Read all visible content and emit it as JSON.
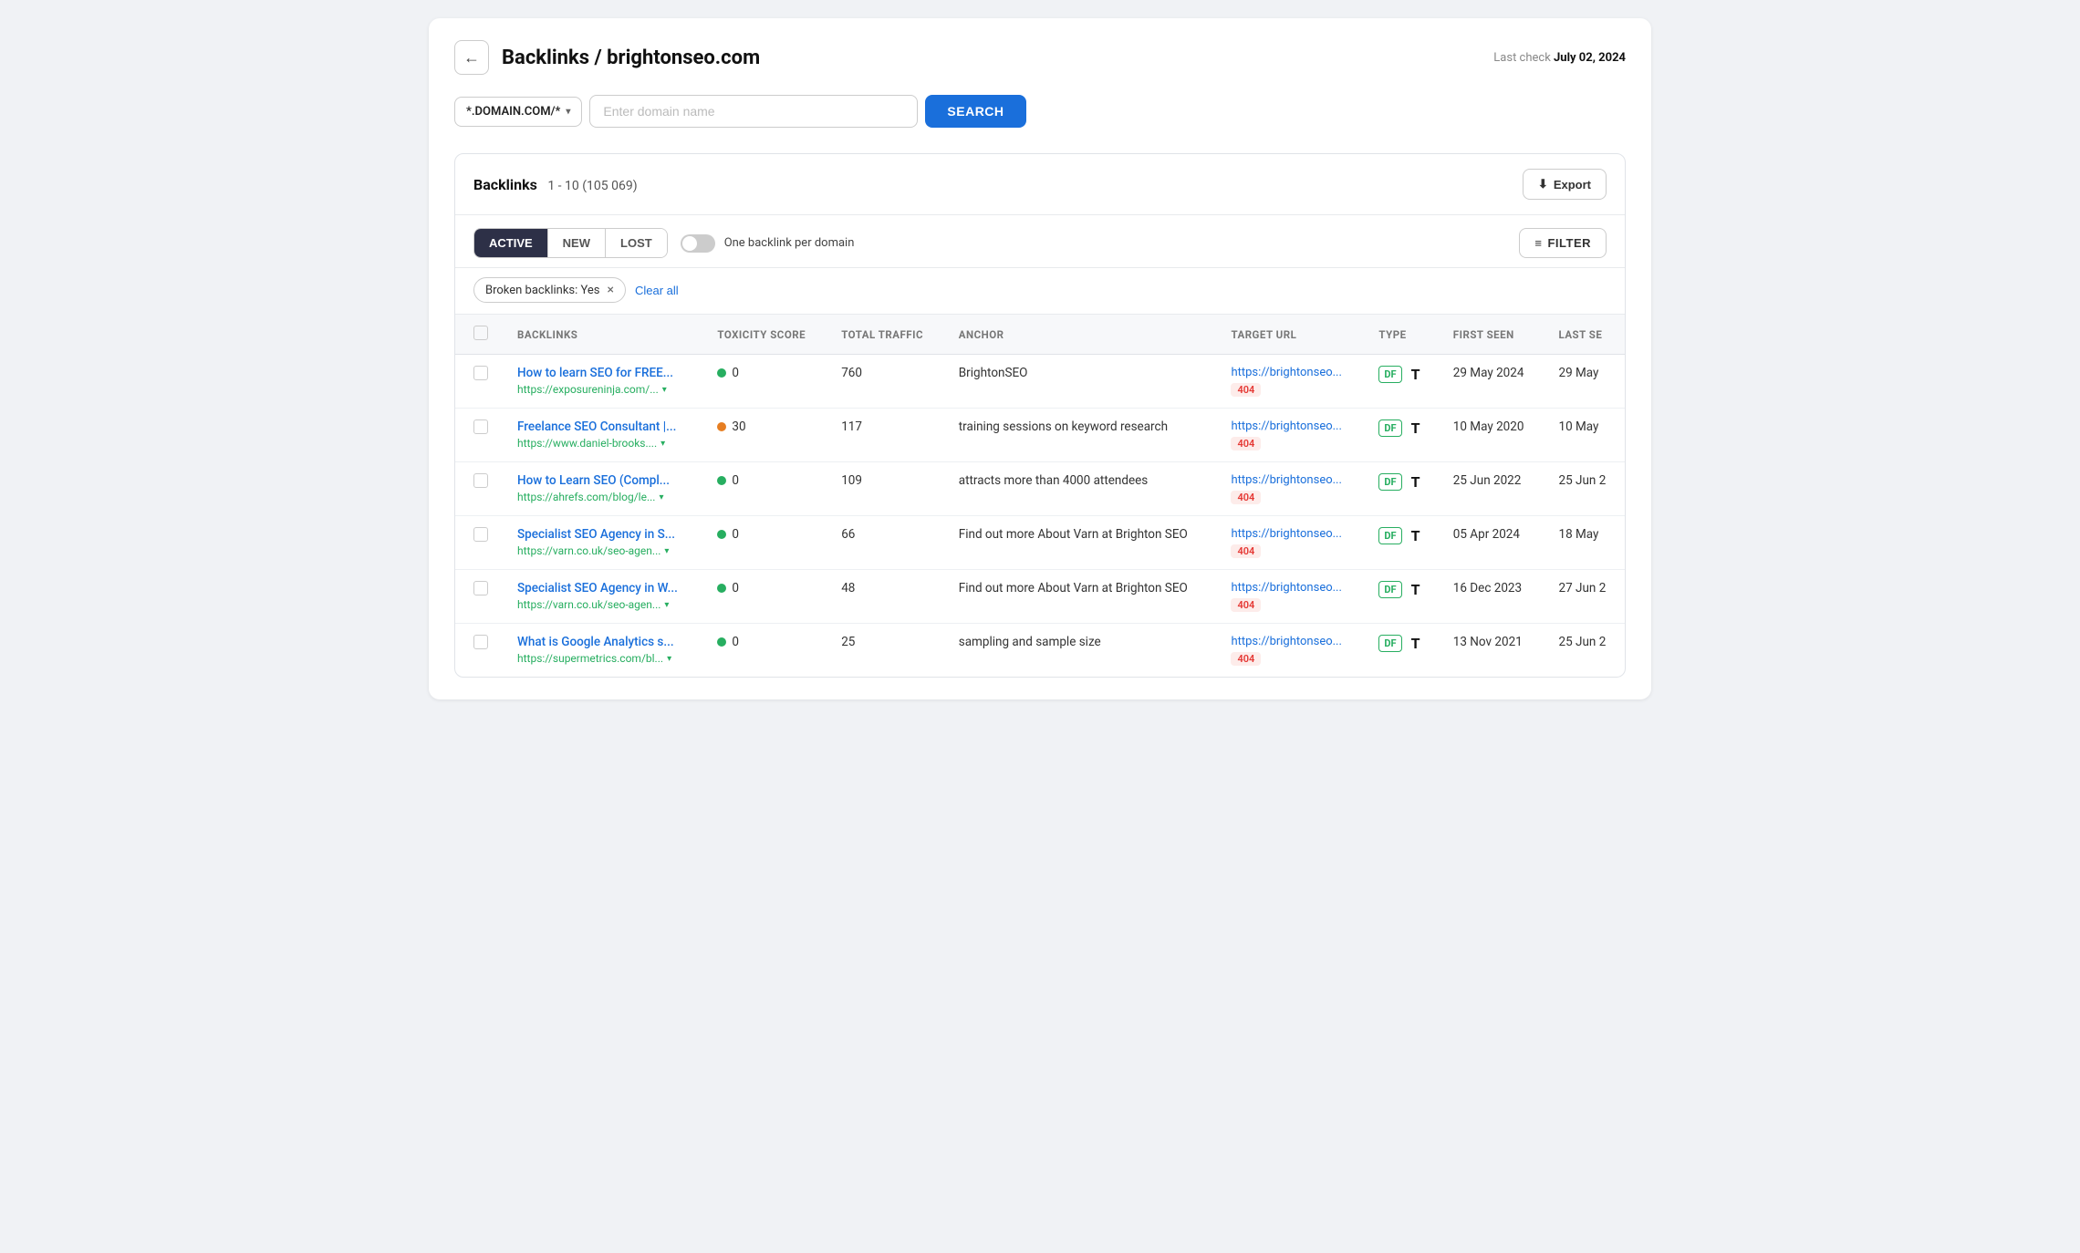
{
  "header": {
    "back_label": "←",
    "title": "Backlinks / brightonseo.com",
    "last_check_label": "Last check",
    "last_check_date": "July 02, 2024"
  },
  "search_bar": {
    "domain_select_label": "*.DOMAIN.COM/*",
    "input_placeholder": "Enter domain name",
    "search_button": "SEARCH"
  },
  "backlinks_section": {
    "title": "Backlinks",
    "count": "1 - 10 (105 069)",
    "export_button": "Export",
    "tabs": [
      "ACTIVE",
      "NEW",
      "LOST"
    ],
    "active_tab": "ACTIVE",
    "toggle_label": "One backlink per domain",
    "filter_button": "FILTER",
    "filter_tag": "Broken backlinks: Yes",
    "clear_all": "Clear all"
  },
  "table": {
    "columns": [
      "",
      "BACKLINKS",
      "TOXICITY SCORE",
      "TOTAL TRAFFIC",
      "ANCHOR",
      "TARGET URL",
      "TYPE",
      "FIRST SEEN",
      "LAST SE"
    ],
    "rows": [
      {
        "title": "How to learn SEO for FREE...",
        "url": "https://exposureninja.com/...",
        "toxicity": "0",
        "toxicity_type": "green",
        "traffic": "760",
        "anchor": "BrightonSEO",
        "target_url": "https://brightonseo...",
        "target_badge": "404",
        "type_df": "DF",
        "type_t": "T",
        "first_seen": "29 May 2024",
        "last_seen": "29 May"
      },
      {
        "title": "Freelance SEO Consultant |...",
        "url": "https://www.daniel-brooks....",
        "toxicity": "30",
        "toxicity_type": "orange",
        "traffic": "117",
        "anchor": "training sessions on keyword research",
        "target_url": "https://brightonseo...",
        "target_badge": "404",
        "type_df": "DF",
        "type_t": "T",
        "first_seen": "10 May 2020",
        "last_seen": "10 May"
      },
      {
        "title": "How to Learn SEO (Compl...",
        "url": "https://ahrefs.com/blog/le...",
        "toxicity": "0",
        "toxicity_type": "green",
        "traffic": "109",
        "anchor": "attracts more than 4000 attendees",
        "target_url": "https://brightonseo...",
        "target_badge": "404",
        "type_df": "DF",
        "type_t": "T",
        "first_seen": "25 Jun 2022",
        "last_seen": "25 Jun 2"
      },
      {
        "title": "Specialist SEO Agency in S...",
        "url": "https://varn.co.uk/seo-agen...",
        "toxicity": "0",
        "toxicity_type": "green",
        "traffic": "66",
        "anchor": "Find out more About Varn at Brighton SEO",
        "target_url": "https://brightonseo...",
        "target_badge": "404",
        "type_df": "DF",
        "type_t": "T",
        "first_seen": "05 Apr 2024",
        "last_seen": "18 May"
      },
      {
        "title": "Specialist SEO Agency in W...",
        "url": "https://varn.co.uk/seo-agen...",
        "toxicity": "0",
        "toxicity_type": "green",
        "traffic": "48",
        "anchor": "Find out more About Varn at Brighton SEO",
        "target_url": "https://brightonseo...",
        "target_badge": "404",
        "type_df": "DF",
        "type_t": "T",
        "first_seen": "16 Dec 2023",
        "last_seen": "27 Jun 2"
      },
      {
        "title": "What is Google Analytics s...",
        "url": "https://supermetrics.com/bl...",
        "toxicity": "0",
        "toxicity_type": "green",
        "traffic": "25",
        "anchor": "sampling and sample size",
        "target_url": "https://brightonseo...",
        "target_badge": "404",
        "type_df": "DF",
        "type_t": "T",
        "first_seen": "13 Nov 2021",
        "last_seen": "25 Jun 2"
      }
    ]
  },
  "icons": {
    "back": "←",
    "download": "⬇",
    "filter": "≡",
    "chevron_down": "▾",
    "close": "×"
  }
}
